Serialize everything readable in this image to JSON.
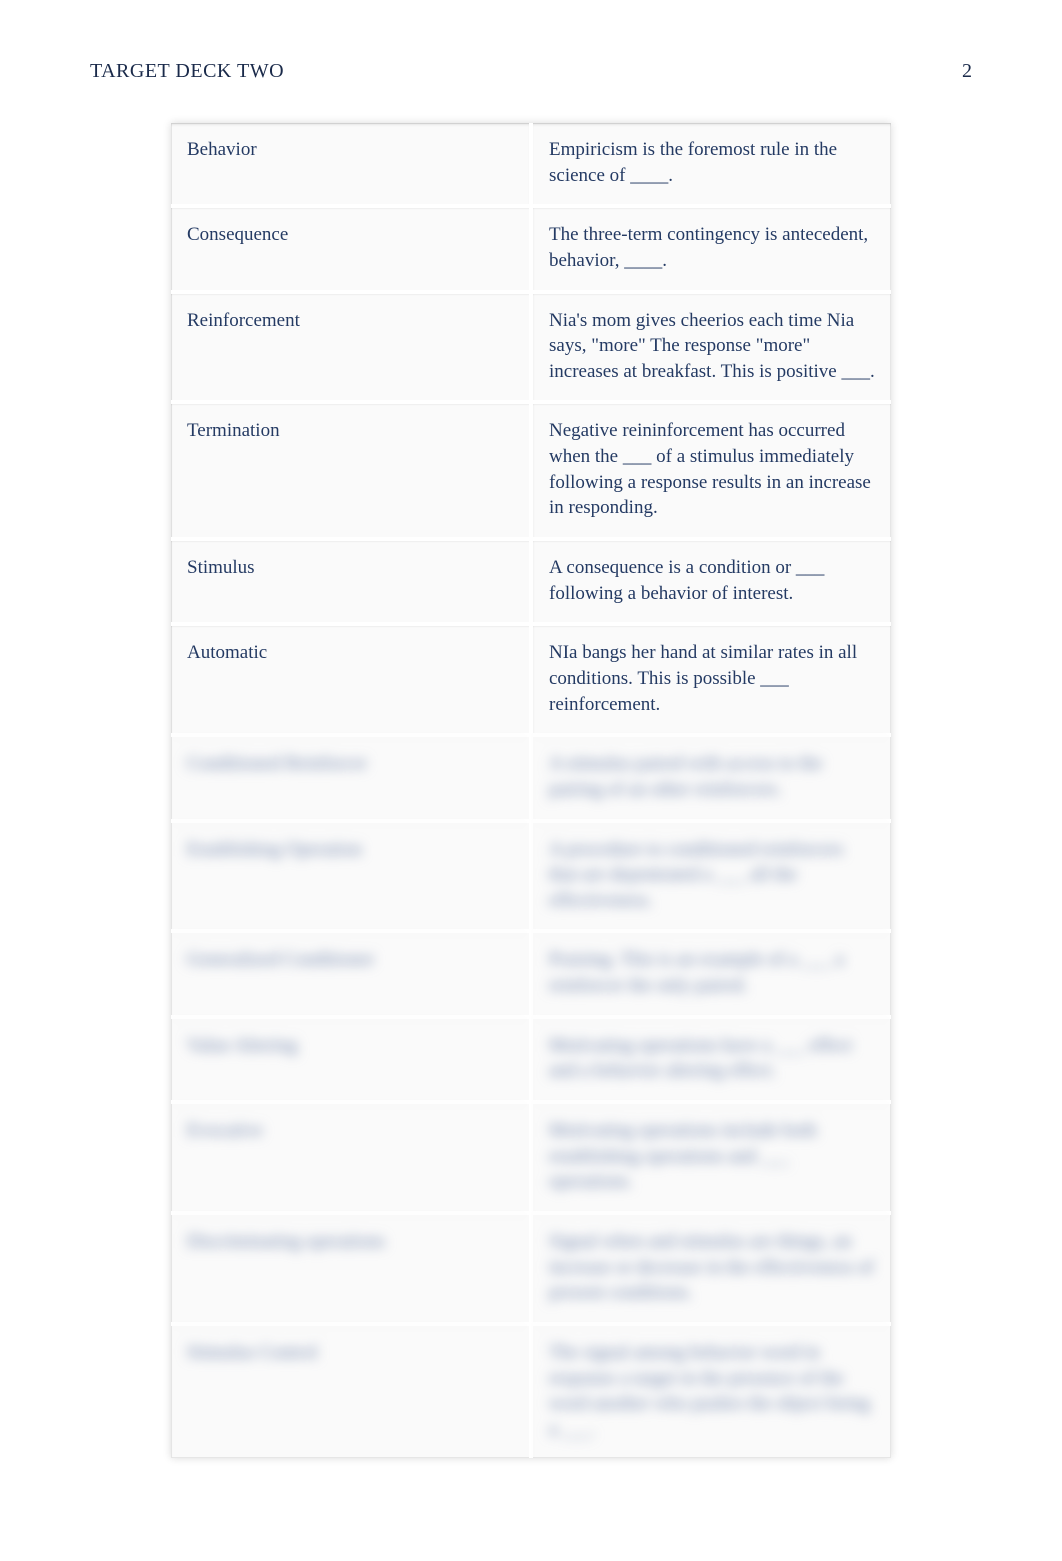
{
  "header": {
    "title": "TARGET DECK TWO",
    "page_number": "2"
  },
  "table": {
    "rows": [
      {
        "left": "Behavior",
        "right": "Empiricism is the foremost rule in the science of ____.",
        "blurred": false
      },
      {
        "left": "Consequence",
        "right": "The three-term contingency is antecedent, behavior, ____.",
        "blurred": false
      },
      {
        "left": "Reinforcement",
        "right": "Nia's mom gives cheerios each time Nia says, \"more\" The response \"more\" increases at breakfast. This is positive ___.",
        "blurred": false
      },
      {
        "left": "Termination",
        "right": "Negative reininforcement has occurred when the ___ of a stimulus immediately following a response results in an increase in responding.",
        "blurred": false
      },
      {
        "left": "Stimulus",
        "right": "A consequence is a condition or ___ following a behavior of interest.",
        "blurred": false
      },
      {
        "left": "Automatic",
        "right": "NIa bangs her hand at similar rates in all conditions. This is possible ___ reinforcement.",
        "blurred": false
      },
      {
        "left": "Conditioned Reinforcer",
        "right": "A stimulus paired with access to the pairing of an other reinforcers.",
        "blurred": true
      },
      {
        "left": "Establishing Operation",
        "right": "A procedure to conditioned reinforcers that are depentrated a ___ all the effectiveness.",
        "blurred": true
      },
      {
        "left": "Generalized Conditioner",
        "right": "Praising. This is an example of a ___ a reinforcer the only paired.",
        "blurred": true
      },
      {
        "left": "Value Altering",
        "right": "Motivating operations have a ___ effect and a behavior altering effect.",
        "blurred": true
      },
      {
        "left": "Evocative",
        "right": "Motivating operations include both establishing operations and ___ operations.",
        "blurred": true
      },
      {
        "left": "Discriminating operations",
        "right": "Signal when and stimulus are things, an increase or decrease in the effectiveness of present conditions.",
        "blurred": true
      },
      {
        "left": "Stimulus Control",
        "right": "The signal among behavior word in response a target in the presence of the word another who pushes the object being a ___.",
        "blurred": true
      }
    ]
  }
}
